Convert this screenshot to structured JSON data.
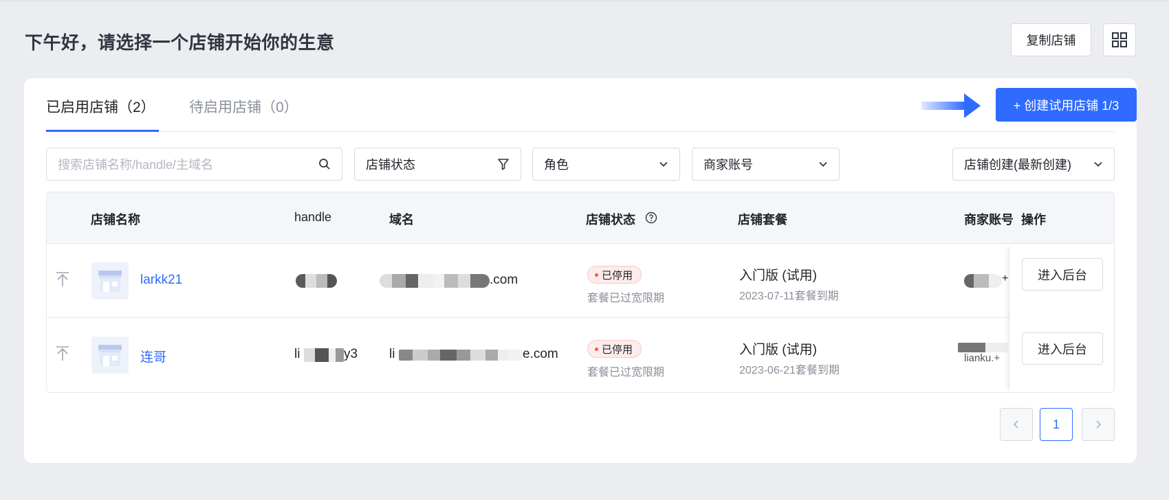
{
  "greeting": "下午好，请选择一个店铺开始你的生意",
  "header": {
    "copy_store_label": "复制店铺",
    "grid_icon": "grid-icon"
  },
  "tabs": [
    {
      "label": "已启用店铺（2）",
      "active": true
    },
    {
      "label": "待启用店铺（0）",
      "active": false
    }
  ],
  "create_button_label": "+ 创建试用店铺 1/3",
  "filters": {
    "search_placeholder": "搜索店铺名称/handle/主域名",
    "status_label": "店铺状态",
    "role_label": "角色",
    "merchant_label": "商家账号",
    "sort_label": "店铺创建(最新创建)"
  },
  "table": {
    "headers": [
      "店铺名称",
      "handle",
      "域名",
      "店铺状态",
      "店铺套餐",
      "商家账号",
      "操作"
    ],
    "rows": [
      {
        "name": "larkk21",
        "handle_visible": "",
        "domain_visible": ".com",
        "status": "已停用",
        "status_sub": "套餐已过宽限期",
        "plan": "入门版 (试用)",
        "plan_expiry": "2023-07-11套餐到期",
        "merchant_visible": "+",
        "action": "进入后台"
      },
      {
        "name": "连哥",
        "handle_visible_prefix": "li",
        "handle_visible_suffix": "y3",
        "domain_visible_prefix": "li",
        "domain_visible_suffix": "e.com",
        "status": "已停用",
        "status_sub": "套餐已过宽限期",
        "plan": "入门版 (试用)",
        "plan_expiry": "2023-06-21套餐到期",
        "merchant_visible": "lianku.+",
        "action": "进入后台"
      }
    ]
  },
  "pagination": {
    "current": "1"
  },
  "colors": {
    "accent": "#2f6bff",
    "danger": "#f25a45",
    "background": "#ecedf1"
  }
}
